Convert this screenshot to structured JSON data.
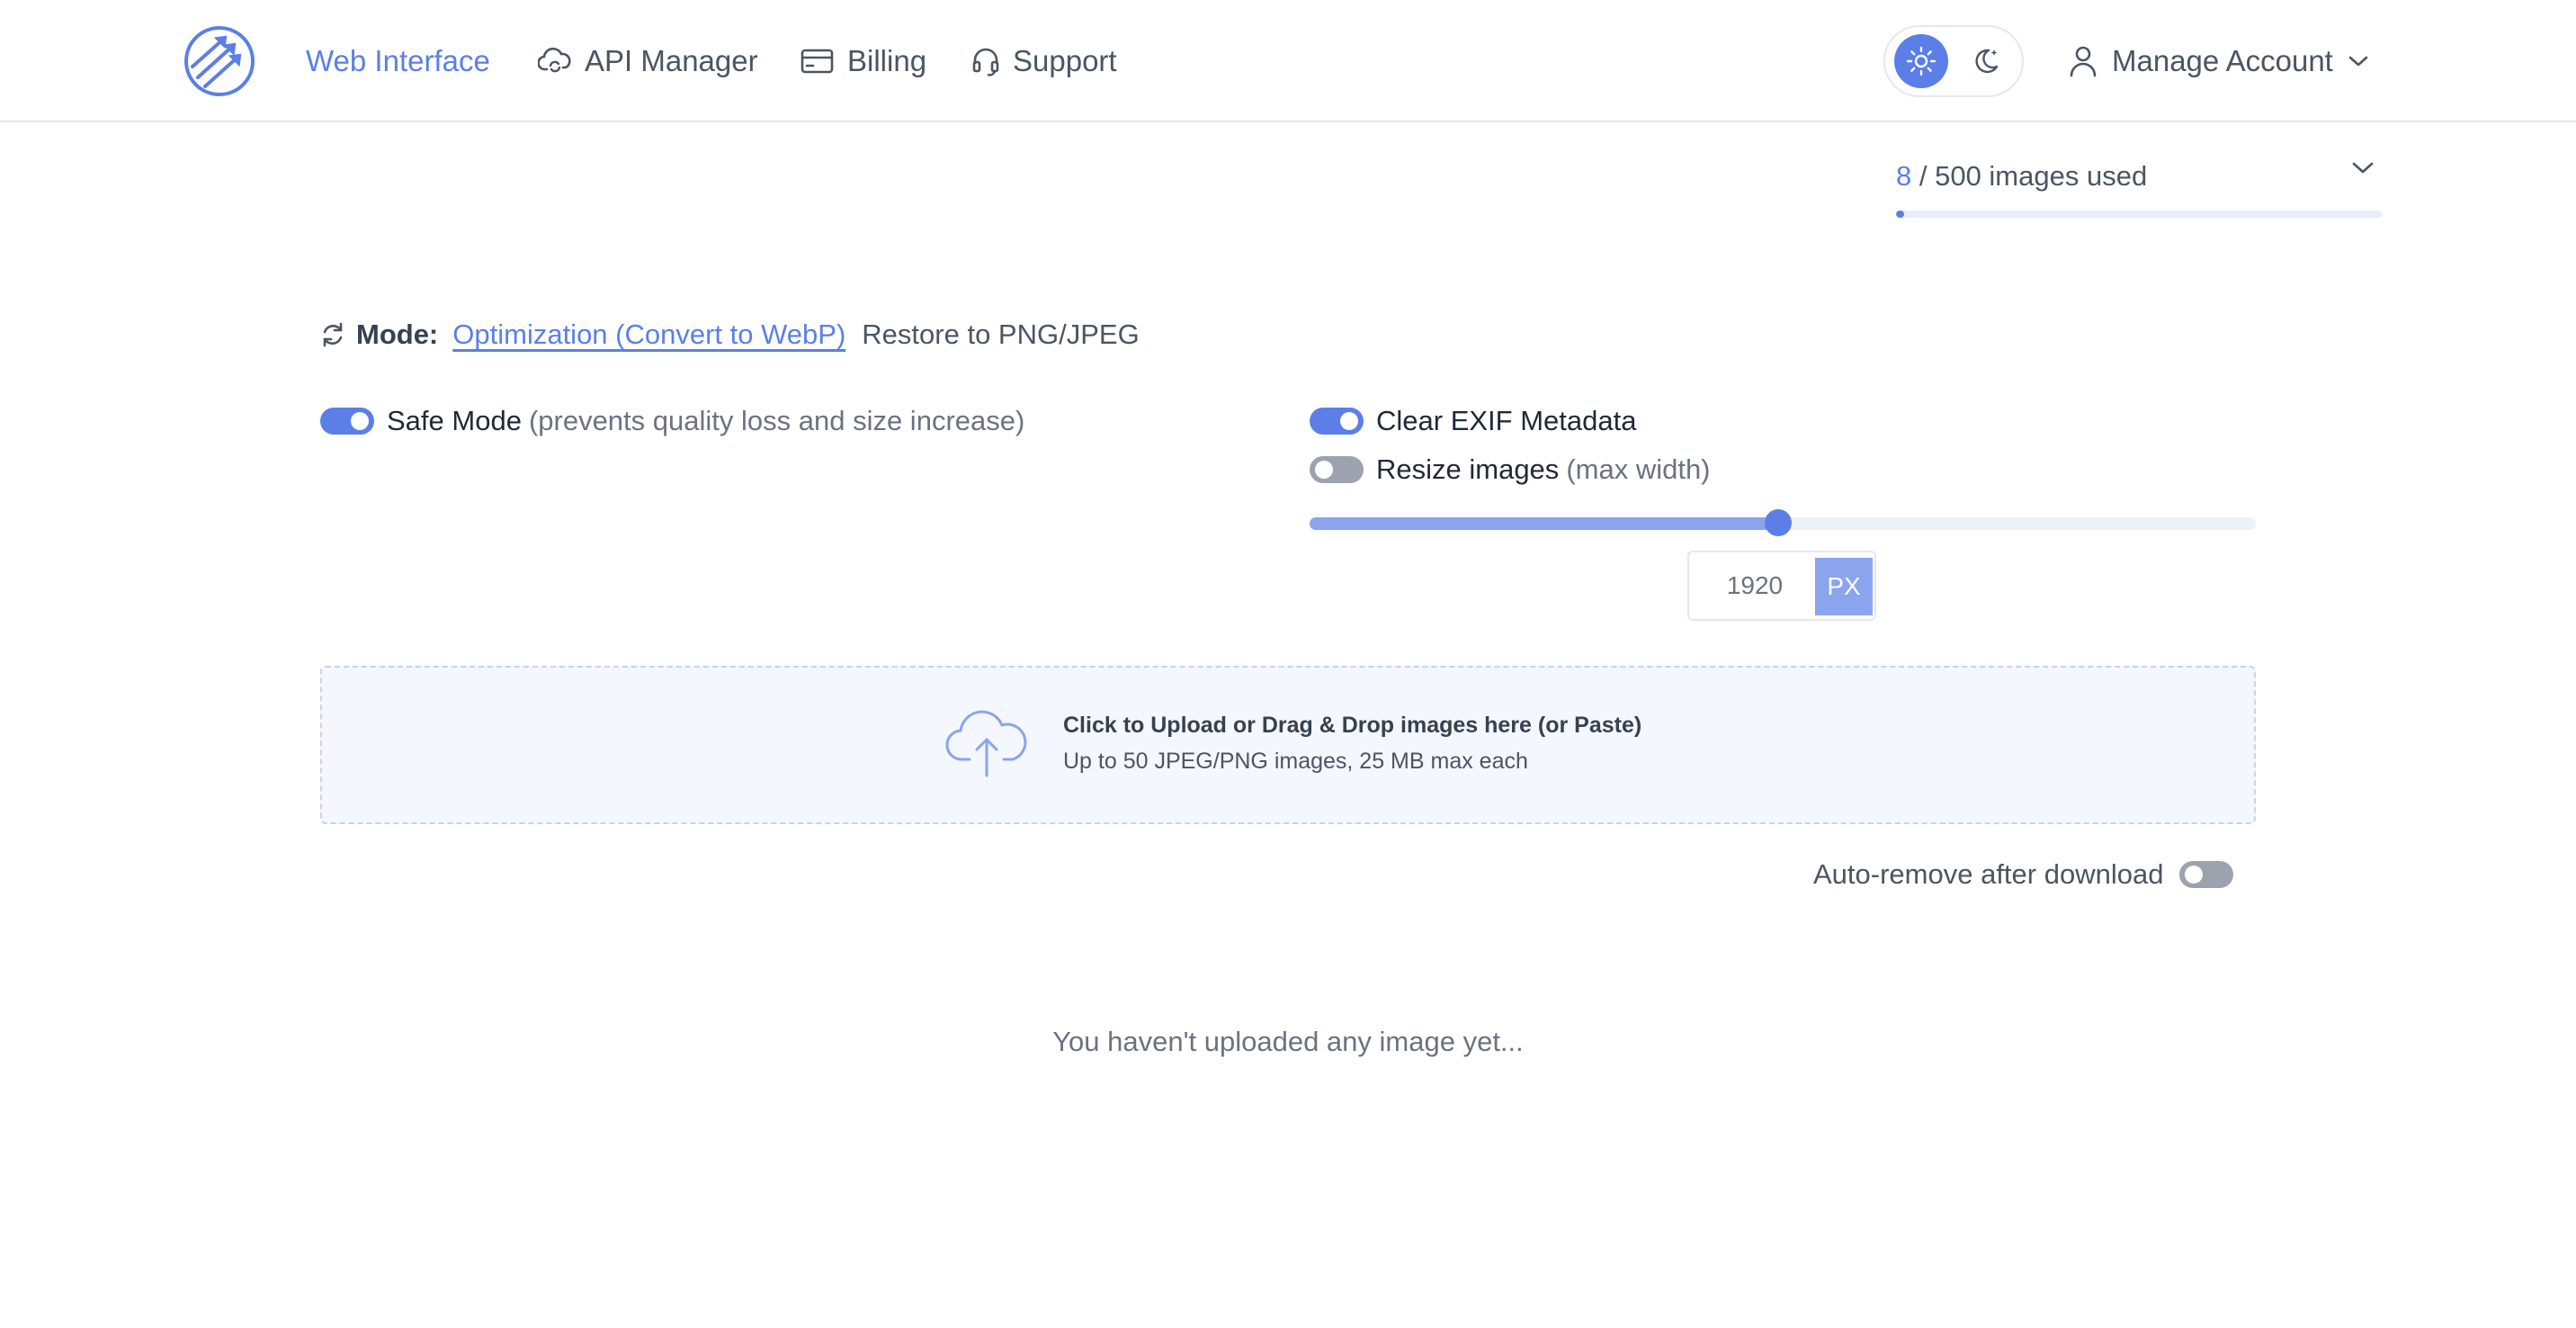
{
  "header": {
    "nav": [
      {
        "label": "Web Interface",
        "icon": "none",
        "active": true
      },
      {
        "label": "API Manager",
        "icon": "cloud-sync-icon",
        "active": false
      },
      {
        "label": "Billing",
        "icon": "credit-card-icon",
        "active": false
      },
      {
        "label": "Support",
        "icon": "headset-icon",
        "active": false
      }
    ],
    "theme": {
      "selected": "light"
    },
    "account_label": "Manage Account"
  },
  "usage": {
    "used": "8",
    "rest": " / 500 images used",
    "fraction": 0.016
  },
  "mode": {
    "label": "Mode:",
    "options": [
      {
        "label": "Optimization (Convert to WebP)",
        "active": true
      },
      {
        "label": "Restore to PNG/JPEG",
        "active": false
      }
    ]
  },
  "options": {
    "safe_mode": {
      "label": "Safe Mode",
      "hint": "(prevents quality loss and size increase)",
      "on": true
    },
    "clear_exif": {
      "label": "Clear EXIF Metadata",
      "on": true
    },
    "resize": {
      "label": "Resize images",
      "hint": "(max width)",
      "on": false
    },
    "width": {
      "value": "1920",
      "unit": "PX",
      "slider_fraction": 0.495
    }
  },
  "upload": {
    "title": "Click to Upload or Drag & Drop images here (or Paste)",
    "subtitle": "Up to 50 JPEG/PNG images, 25 MB max each"
  },
  "auto_remove": {
    "label": "Auto-remove after download",
    "on": false
  },
  "empty_state": "You haven't uploaded any image yet...",
  "colors": {
    "accent": "#5b7fe6",
    "accent_light": "#8aa4ee",
    "switch_off": "#9ca3af"
  }
}
